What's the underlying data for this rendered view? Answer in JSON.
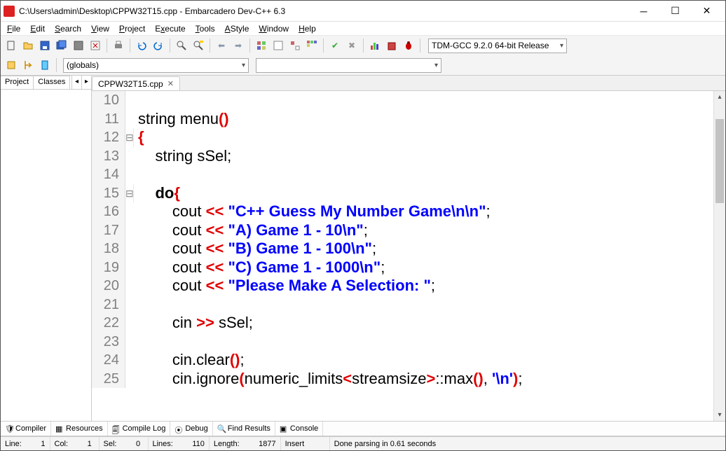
{
  "window": {
    "title": "C:\\Users\\admin\\Desktop\\CPPW32T15.cpp - Embarcadero Dev-C++ 6.3"
  },
  "menu": {
    "file": "File",
    "edit": "Edit",
    "search": "Search",
    "view": "View",
    "project": "Project",
    "execute": "Execute",
    "tools": "Tools",
    "astyle": "AStyle",
    "window": "Window",
    "help": "Help"
  },
  "compiler_combo": "TDM-GCC 9.2.0 64-bit Release",
  "globals_combo": "(globals)",
  "left_tabs": {
    "project": "Project",
    "classes": "Classes"
  },
  "file_tab": {
    "name": "CPPW32T15.cpp"
  },
  "code": {
    "lines": [
      {
        "n": 10,
        "fold": "",
        "tokens": []
      },
      {
        "n": 11,
        "fold": "",
        "tokens": [
          [
            "id",
            "string"
          ],
          [
            "sp",
            " "
          ],
          [
            "id",
            "menu"
          ],
          [
            "op",
            "()"
          ]
        ]
      },
      {
        "n": 12,
        "fold": "⊟",
        "tokens": [
          [
            "op",
            "{"
          ]
        ]
      },
      {
        "n": 13,
        "fold": "",
        "tokens": [
          [
            "sp",
            "    "
          ],
          [
            "id",
            "string"
          ],
          [
            "sp",
            " "
          ],
          [
            "id",
            "sSel"
          ],
          [
            "pun",
            ";"
          ]
        ]
      },
      {
        "n": 14,
        "fold": "",
        "tokens": []
      },
      {
        "n": 15,
        "fold": "⊟",
        "tokens": [
          [
            "sp",
            "    "
          ],
          [
            "kw",
            "do"
          ],
          [
            "op",
            "{"
          ]
        ]
      },
      {
        "n": 16,
        "fold": "",
        "tokens": [
          [
            "sp",
            "        "
          ],
          [
            "id",
            "cout"
          ],
          [
            "sp",
            " "
          ],
          [
            "op",
            "<<"
          ],
          [
            "sp",
            " "
          ],
          [
            "str",
            "\"C++ Guess My Number Game\\n\\n\""
          ],
          [
            "pun",
            ";"
          ]
        ]
      },
      {
        "n": 17,
        "fold": "",
        "tokens": [
          [
            "sp",
            "        "
          ],
          [
            "id",
            "cout"
          ],
          [
            "sp",
            " "
          ],
          [
            "op",
            "<<"
          ],
          [
            "sp",
            " "
          ],
          [
            "str",
            "\"A) Game 1 - 10\\n\""
          ],
          [
            "pun",
            ";"
          ]
        ]
      },
      {
        "n": 18,
        "fold": "",
        "tokens": [
          [
            "sp",
            "        "
          ],
          [
            "id",
            "cout"
          ],
          [
            "sp",
            " "
          ],
          [
            "op",
            "<<"
          ],
          [
            "sp",
            " "
          ],
          [
            "str",
            "\"B) Game 1 - 100\\n\""
          ],
          [
            "pun",
            ";"
          ]
        ]
      },
      {
        "n": 19,
        "fold": "",
        "tokens": [
          [
            "sp",
            "        "
          ],
          [
            "id",
            "cout"
          ],
          [
            "sp",
            " "
          ],
          [
            "op",
            "<<"
          ],
          [
            "sp",
            " "
          ],
          [
            "str",
            "\"C) Game 1 - 1000\\n\""
          ],
          [
            "pun",
            ";"
          ]
        ]
      },
      {
        "n": 20,
        "fold": "",
        "tokens": [
          [
            "sp",
            "        "
          ],
          [
            "id",
            "cout"
          ],
          [
            "sp",
            " "
          ],
          [
            "op",
            "<<"
          ],
          [
            "sp",
            " "
          ],
          [
            "str",
            "\"Please Make A Selection: \""
          ],
          [
            "pun",
            ";"
          ]
        ]
      },
      {
        "n": 21,
        "fold": "",
        "tokens": []
      },
      {
        "n": 22,
        "fold": "",
        "tokens": [
          [
            "sp",
            "        "
          ],
          [
            "id",
            "cin"
          ],
          [
            "sp",
            " "
          ],
          [
            "op",
            ">>"
          ],
          [
            "sp",
            " "
          ],
          [
            "id",
            "sSel"
          ],
          [
            "pun",
            ";"
          ]
        ]
      },
      {
        "n": 23,
        "fold": "",
        "tokens": []
      },
      {
        "n": 24,
        "fold": "",
        "tokens": [
          [
            "sp",
            "        "
          ],
          [
            "id",
            "cin"
          ],
          [
            "pun",
            "."
          ],
          [
            "id",
            "clear"
          ],
          [
            "op",
            "()"
          ],
          [
            "pun",
            ";"
          ]
        ]
      },
      {
        "n": 25,
        "fold": "",
        "tokens": [
          [
            "sp",
            "        "
          ],
          [
            "id",
            "cin"
          ],
          [
            "pun",
            "."
          ],
          [
            "id",
            "ignore"
          ],
          [
            "op",
            "("
          ],
          [
            "id",
            "numeric_limits"
          ],
          [
            "op",
            "<"
          ],
          [
            "id",
            "streamsize"
          ],
          [
            "op",
            ">"
          ],
          [
            "pun",
            "::"
          ],
          [
            "id",
            "max"
          ],
          [
            "op",
            "()"
          ],
          [
            "pun",
            ", "
          ],
          [
            "str",
            "'\\n'"
          ],
          [
            "op",
            ")"
          ],
          [
            "pun",
            ";"
          ]
        ]
      }
    ]
  },
  "bottom_tabs": {
    "compiler": "Compiler",
    "resources": "Resources",
    "compile_log": "Compile Log",
    "debug": "Debug",
    "find_results": "Find Results",
    "console": "Console"
  },
  "status": {
    "line_label": "Line:",
    "line_val": "1",
    "col_label": "Col:",
    "col_val": "1",
    "sel_label": "Sel:",
    "sel_val": "0",
    "lines_label": "Lines:",
    "lines_val": "110",
    "length_label": "Length:",
    "length_val": "1877",
    "mode": "Insert",
    "message": "Done parsing in 0.61 seconds"
  }
}
